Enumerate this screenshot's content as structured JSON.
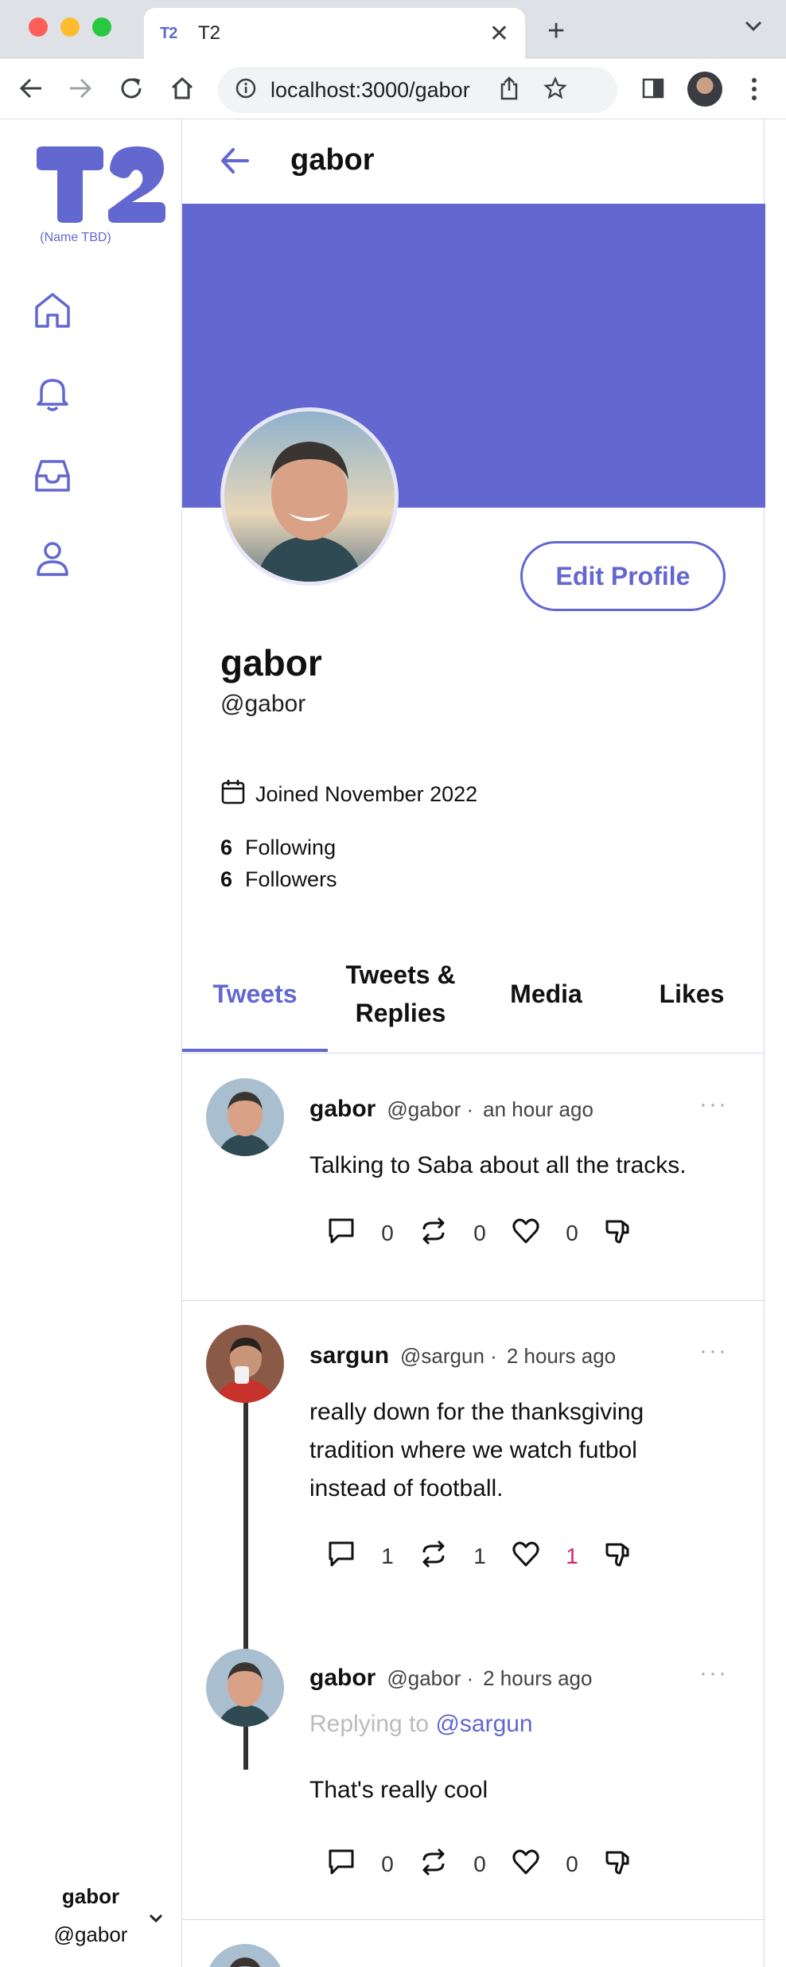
{
  "browser": {
    "tab_title": "T2",
    "tab_favicon": "T2",
    "url": "localhost:3000/gabor",
    "icons": [
      "back-icon",
      "forward-icon",
      "reload-icon",
      "home-icon",
      "info-icon",
      "share-icon",
      "star-icon",
      "sidepanel-icon",
      "profile-icon",
      "menu-icon"
    ]
  },
  "sidebar": {
    "logo_text": "T2",
    "logo_subtitle": "(Name TBD)",
    "nav": [
      {
        "name": "home",
        "icon": "home-icon"
      },
      {
        "name": "notifications",
        "icon": "bell-icon"
      },
      {
        "name": "inbox",
        "icon": "inbox-icon"
      },
      {
        "name": "profile",
        "icon": "user-icon"
      }
    ],
    "user": {
      "name": "gabor",
      "handle": "@gabor"
    }
  },
  "header": {
    "title": "gabor"
  },
  "profile": {
    "banner_color": "#6367d0",
    "edit_label": "Edit Profile",
    "name": "gabor",
    "handle": "@gabor",
    "joined": "Joined November 2022",
    "following_count": "6",
    "following_label": "Following",
    "followers_count": "6",
    "followers_label": "Followers"
  },
  "tabs": [
    {
      "label": "Tweets",
      "active": true
    },
    {
      "label": "Tweets & Replies",
      "active": false
    },
    {
      "label": "Media",
      "active": false
    },
    {
      "label": "Likes",
      "active": false
    }
  ],
  "tweets": [
    {
      "name": "gabor",
      "handle": "@gabor ·",
      "time": "an hour ago",
      "text": "Talking to Saba about all the tracks.",
      "replies": "0",
      "retweets": "0",
      "likes": "0"
    },
    {
      "name": "sargun",
      "handle": "@sargun ·",
      "time": "2 hours ago",
      "text": "really down for the thanksgiving tradition where we watch futbol instead of football.",
      "replies": "1",
      "retweets": "1",
      "likes": "1"
    },
    {
      "name": "gabor",
      "handle": "@gabor ·",
      "time": "2 hours ago",
      "replying_prefix": "Replying to",
      "replying_to": "@sargun",
      "text": "That's really cool",
      "replies": "0",
      "retweets": "0",
      "likes": "0"
    }
  ],
  "colors": {
    "accent": "#6367d0",
    "liked": "#d02669"
  }
}
